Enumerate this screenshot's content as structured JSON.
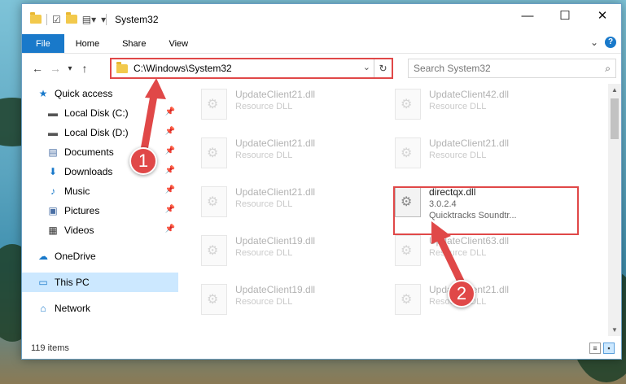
{
  "window": {
    "title": "System32",
    "controls": {
      "minimize": "—",
      "maximize": "☐",
      "close": "✕"
    }
  },
  "ribbon": {
    "tabs": [
      "File",
      "Home",
      "Share",
      "View"
    ],
    "help": "?"
  },
  "nav": {
    "back": "←",
    "forward": "→",
    "recent": "▾",
    "up": "↑",
    "address": "C:\\Windows\\System32",
    "refresh": "↻",
    "search_placeholder": "Search System32"
  },
  "sidebar": {
    "items": [
      {
        "label": "Quick access",
        "icon": "star-icon",
        "glyph": "★",
        "color": "#1979ca"
      },
      {
        "label": "Local Disk (C:)",
        "icon": "drive-icon",
        "glyph": "▬",
        "color": "#555"
      },
      {
        "label": "Local Disk (D:)",
        "icon": "drive-icon",
        "glyph": "▬",
        "color": "#555"
      },
      {
        "label": "Documents",
        "icon": "documents-icon",
        "glyph": "▤",
        "color": "#4a6fa5"
      },
      {
        "label": "Downloads",
        "icon": "downloads-icon",
        "glyph": "⬇",
        "color": "#1979ca"
      },
      {
        "label": "Music",
        "icon": "music-icon",
        "glyph": "♪",
        "color": "#1979ca"
      },
      {
        "label": "Pictures",
        "icon": "pictures-icon",
        "glyph": "▣",
        "color": "#4a6fa5"
      },
      {
        "label": "Videos",
        "icon": "videos-icon",
        "glyph": "▦",
        "color": "#333"
      },
      {
        "label": "OneDrive",
        "icon": "onedrive-icon",
        "glyph": "☁",
        "color": "#1979ca"
      },
      {
        "label": "This PC",
        "icon": "computer-icon",
        "glyph": "▭",
        "color": "#1979ca"
      },
      {
        "label": "Network",
        "icon": "network-icon",
        "glyph": "⌂",
        "color": "#1979ca"
      }
    ]
  },
  "files": [
    {
      "name": "UpdateClient21.dll",
      "desc": "Resource DLL"
    },
    {
      "name": "UpdateClient42.dll",
      "desc": "Resource DLL"
    },
    {
      "name": "UpdateClient21.dll",
      "desc": "Resource DLL"
    },
    {
      "name": "UpdateClient21.dll",
      "desc": "Resource DLL"
    },
    {
      "name": "UpdateClient21.dll",
      "desc": "Resource DLL"
    },
    {
      "name": "directqx.dll",
      "desc": "3.0.2.4",
      "desc2": "Quicktracks Soundtr..."
    },
    {
      "name": "UpdateClient19.dll",
      "desc": "Resource DLL"
    },
    {
      "name": "UpdateClient63.dll",
      "desc": "Resource DLL"
    },
    {
      "name": "UpdateClient19.dll",
      "desc": "Resource DLL"
    },
    {
      "name": "UpdateClient21.dll",
      "desc": "Resource DLL"
    }
  ],
  "status": {
    "count": "119 items"
  },
  "annotations": {
    "step1": "1",
    "step2": "2",
    "color": "#e04848"
  }
}
